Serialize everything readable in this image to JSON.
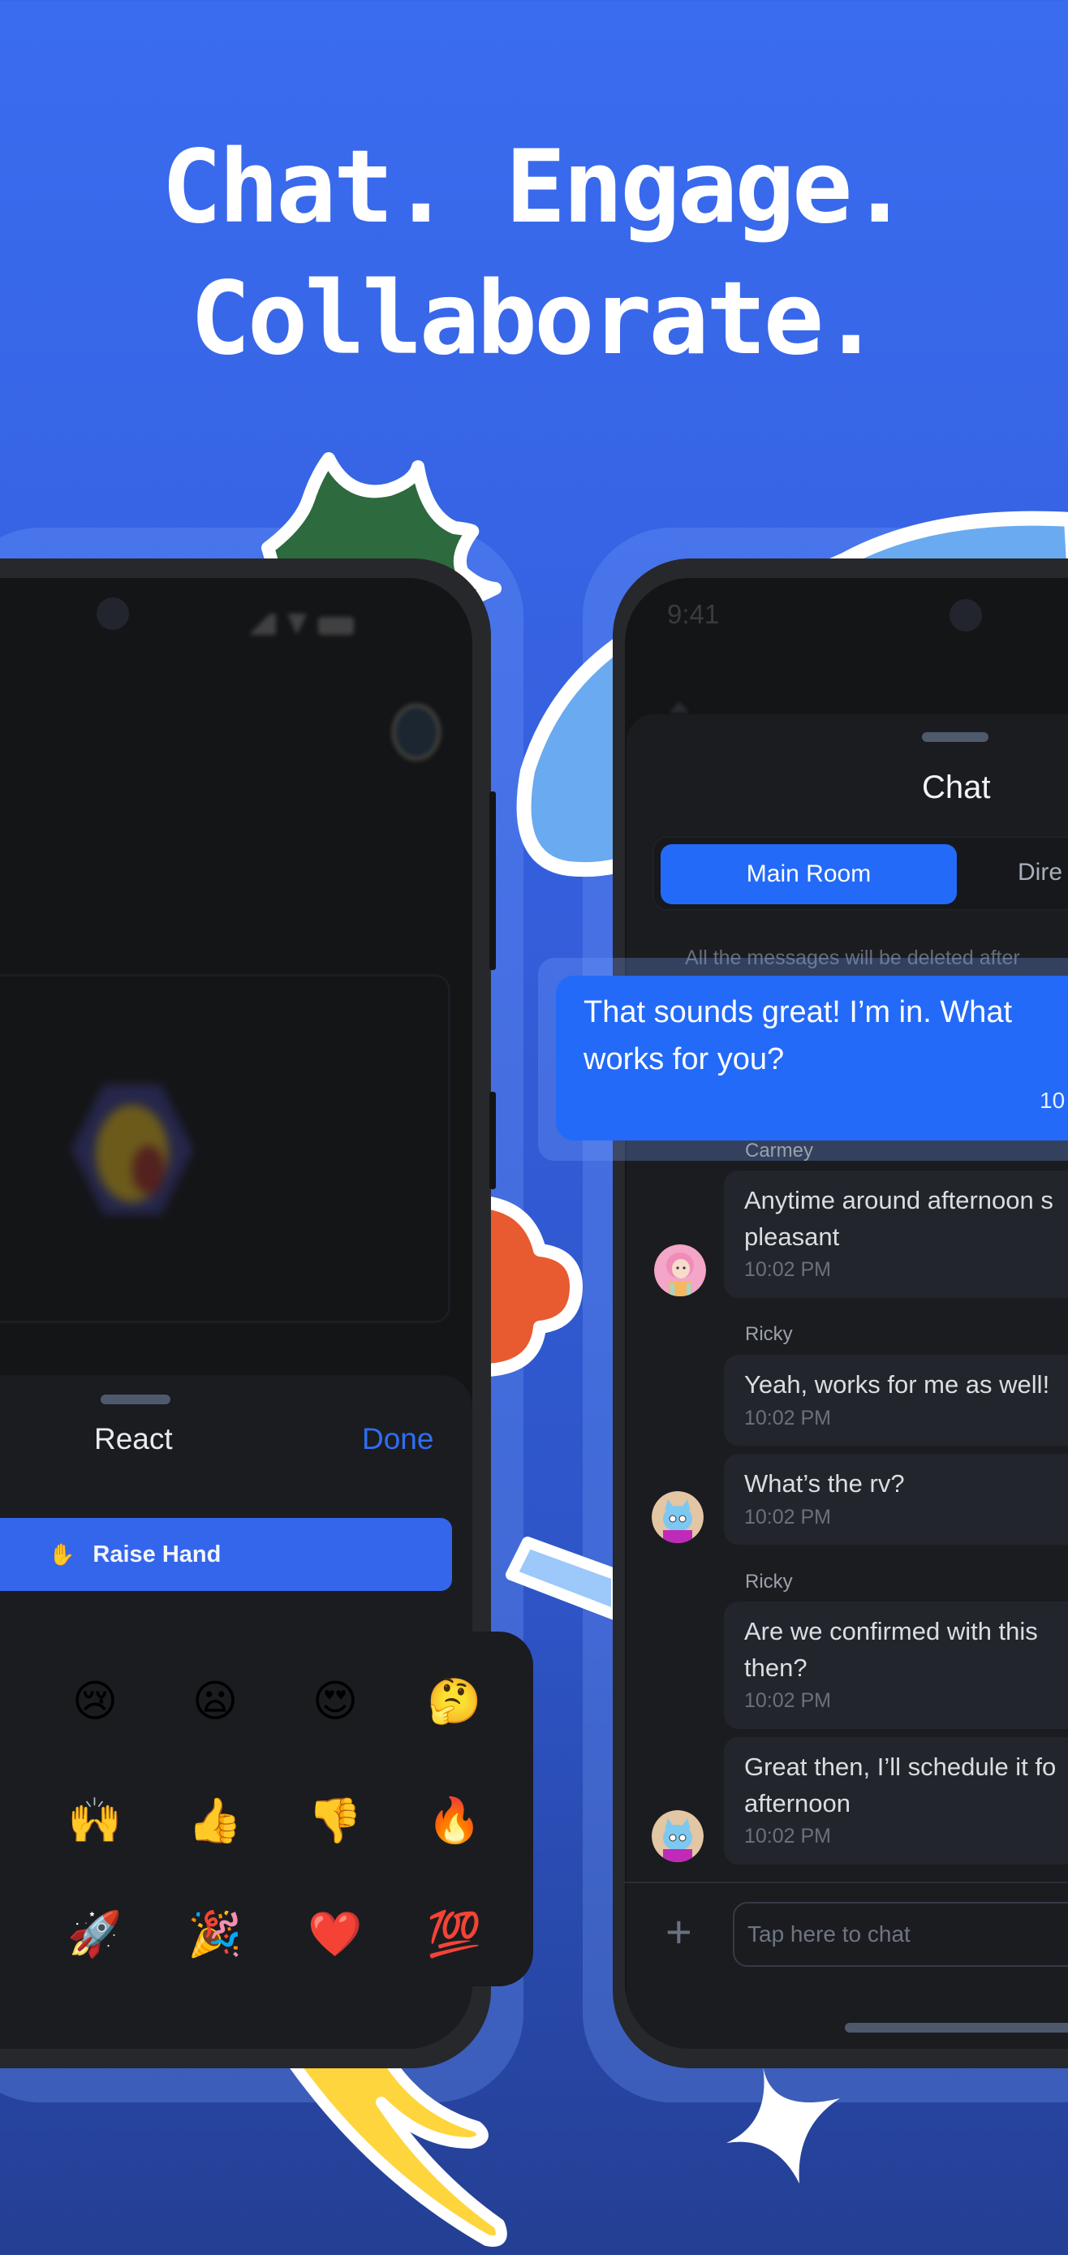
{
  "headline": {
    "line1": "Chat. Engage.",
    "line2": "Collaborate."
  },
  "colors": {
    "background": "#3560de",
    "accent_blue": "#236af8",
    "button_blue": "#3466ec",
    "done_blue": "#2f6ef2",
    "sheet_bg": "#1b1c20",
    "bubble_bg": "#23252c",
    "sticker_green": "#2d6a3e",
    "sticker_orange": "#e85a30",
    "sticker_light_blue": "#6aaaf0",
    "sticker_yellow": "#ffd53d"
  },
  "left_phone": {
    "react_sheet": {
      "title": "React",
      "done_label": "Done",
      "raise_hand": {
        "icon": "raised-hand-emoji",
        "emoji": "✋",
        "label": "Raise Hand"
      }
    },
    "emoji_grid": [
      {
        "name": "crying-face",
        "char": "😢"
      },
      {
        "name": "frowning-face",
        "char": "😦"
      },
      {
        "name": "heart-eyes",
        "char": "😍"
      },
      {
        "name": "thinking-face",
        "char": "🤔"
      },
      {
        "name": "raising-hands",
        "char": "🙌"
      },
      {
        "name": "thumbs-up",
        "char": "👍"
      },
      {
        "name": "thumbs-down",
        "char": "👎"
      },
      {
        "name": "fire",
        "char": "🔥"
      },
      {
        "name": "rocket",
        "char": "🚀"
      },
      {
        "name": "party-popper",
        "char": "🎉"
      },
      {
        "name": "red-heart",
        "char": "❤️"
      },
      {
        "name": "hundred-points",
        "char": "💯"
      }
    ]
  },
  "right_phone": {
    "status_time": "9:41",
    "chat_sheet": {
      "title": "Chat",
      "tabs": [
        {
          "label": "Main Room",
          "active": true
        },
        {
          "label": "Dire",
          "active": false
        }
      ],
      "notice": "All the messages will be deleted after"
    },
    "messages": [
      {
        "sender": "",
        "own": true,
        "lines": [
          "That sounds great! I’m in. What",
          "works for you?"
        ],
        "time": "10"
      },
      {
        "sender": "Carmey",
        "own": false,
        "lines": [
          "Anytime around afternoon s",
          "pleasant"
        ],
        "time": "10:02 PM",
        "avatar": "carmey-avatar"
      },
      {
        "sender": "Ricky",
        "own": false,
        "lines": [
          "Yeah, works for me as well!"
        ],
        "time": "10:02 PM"
      },
      {
        "sender": "",
        "own": false,
        "lines": [
          "What’s the rv?"
        ],
        "time": "10:02 PM",
        "avatar": "ricky-avatar"
      },
      {
        "sender": "Ricky",
        "own": false,
        "lines": [
          "Are we confirmed with this",
          "then?"
        ],
        "time": "10:02 PM"
      },
      {
        "sender": "",
        "own": false,
        "lines": [
          "Great then, I’ll schedule it fo",
          "afternoon"
        ],
        "time": "10:02 PM",
        "avatar": "ricky-avatar"
      }
    ],
    "composer": {
      "add_icon": "plus-icon",
      "placeholder": "Tap here to chat",
      "value": ""
    }
  }
}
